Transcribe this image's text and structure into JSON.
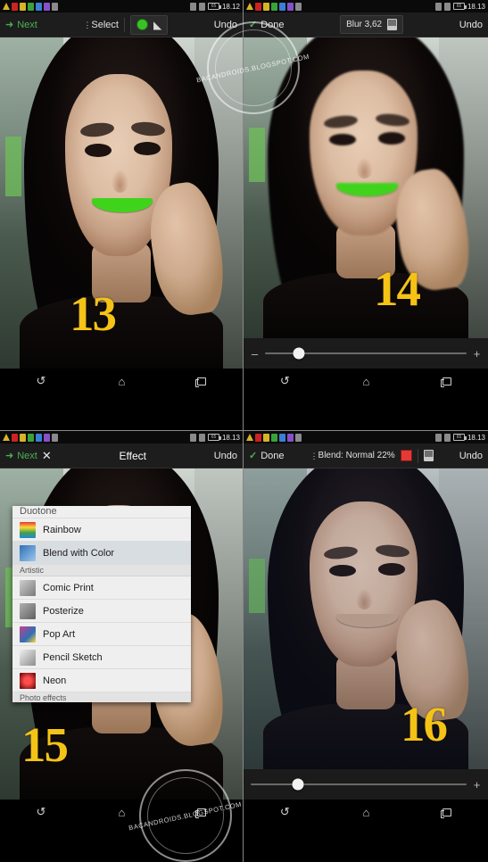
{
  "panels": [
    {
      "id": "panel-13",
      "step_number": "13",
      "status_bar": {
        "time": "18.12",
        "battery": "65"
      },
      "action_bar": {
        "next_label": "Next",
        "select_label": "Select",
        "undo_label": "Undo",
        "color_swatch": "#39c226",
        "tools": [
          "dots-icon",
          "select-label",
          "color-swatch-green",
          "eraser-icon"
        ]
      },
      "nav": [
        "back-icon",
        "home-icon",
        "recents-icon"
      ]
    },
    {
      "id": "panel-14",
      "step_number": "14",
      "status_bar": {
        "time": "18.13",
        "battery": "65"
      },
      "action_bar": {
        "done_label": "Done",
        "effect_label": "Blur 3,62",
        "undo_label": "Undo"
      },
      "slider": {
        "minus": "–",
        "plus": "+",
        "value_percent": 17
      },
      "nav": [
        "back-icon",
        "home-icon",
        "recents-icon"
      ]
    },
    {
      "id": "panel-15",
      "step_number": "15",
      "status_bar": {
        "time": "18.13",
        "battery": "65"
      },
      "action_bar": {
        "next_label": "Next",
        "close_label": "✕",
        "title": "Effect",
        "undo_label": "Undo"
      },
      "effect_list": {
        "clipped_top_item": "Duotone",
        "items": [
          {
            "label": "Rainbow",
            "color": "#3aa0e0",
            "selected": false
          },
          {
            "label": "Blend with Color",
            "color": "#2f6fb5",
            "selected": true
          }
        ],
        "section_header": "Artistic",
        "artistic_items": [
          {
            "label": "Comic Print",
            "color": "#9a9a9a"
          },
          {
            "label": "Posterize",
            "color": "#8d8d8d"
          },
          {
            "label": "Pop Art",
            "color": "#c4408f"
          },
          {
            "label": "Pencil Sketch",
            "color": "#b5b5b5"
          },
          {
            "label": "Neon",
            "color": "#d02a2a"
          }
        ],
        "footer_header": "Photo effects"
      },
      "nav": [
        "back-icon",
        "home-icon",
        "recents-icon"
      ]
    },
    {
      "id": "panel-16",
      "step_number": "16",
      "status_bar": {
        "time": "18.13",
        "battery": "65"
      },
      "action_bar": {
        "done_label": "Done",
        "blend_label": "Blend: Normal 22%",
        "color_swatch": "#e53935",
        "undo_label": "Undo"
      },
      "slider": {
        "plus": "+",
        "value_percent": 22
      },
      "nav": [
        "back-icon",
        "home-icon",
        "recents-icon"
      ]
    }
  ],
  "watermarks": [
    {
      "text": "BACANDROIDS.BLOGSPOT.COM"
    },
    {
      "text": "BACANDROIDS.BLOGSPOT.COM"
    }
  ]
}
